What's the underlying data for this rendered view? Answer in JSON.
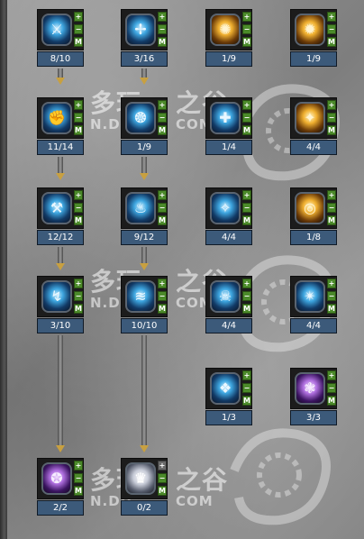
{
  "watermarks": [
    {
      "big": "多玩",
      "small": "N.DU"
    },
    {
      "big": "之谷",
      "small": "COM"
    }
  ],
  "skills": [
    {
      "id": "s1",
      "level": "8/10",
      "icon": "sword-slash-icon",
      "glyph": "⚔",
      "style": "blue",
      "plus_enabled": true
    },
    {
      "id": "s2",
      "level": "3/16",
      "icon": "axe-icon",
      "glyph": "✢",
      "style": "blue",
      "plus_enabled": true
    },
    {
      "id": "s3",
      "level": "1/9",
      "icon": "sun-icon",
      "glyph": "✺",
      "style": "gold",
      "plus_enabled": true
    },
    {
      "id": "s4",
      "level": "1/9",
      "icon": "flame-burst-icon",
      "glyph": "✹",
      "style": "gold",
      "plus_enabled": true
    },
    {
      "id": "s5",
      "level": "11/14",
      "icon": "fist-icon",
      "glyph": "✊",
      "style": "blue",
      "plus_enabled": true
    },
    {
      "id": "s6",
      "level": "1/9",
      "icon": "shield-orb-icon",
      "glyph": "❂",
      "style": "blue",
      "plus_enabled": true
    },
    {
      "id": "s7",
      "level": "1/4",
      "icon": "armor-icon",
      "glyph": "✚",
      "style": "blue",
      "plus_enabled": true
    },
    {
      "id": "s8",
      "level": "4/4",
      "icon": "fire-icon",
      "glyph": "✦",
      "style": "gold",
      "plus_enabled": true
    },
    {
      "id": "s9",
      "level": "12/12",
      "icon": "hammer-icon",
      "glyph": "⚒",
      "style": "blue",
      "plus_enabled": true
    },
    {
      "id": "s10",
      "level": "9/12",
      "icon": "blue-flame-icon",
      "glyph": "♨",
      "style": "blue",
      "plus_enabled": true
    },
    {
      "id": "s11",
      "level": "4/4",
      "icon": "spirit-icon",
      "glyph": "✧",
      "style": "blue",
      "plus_enabled": true
    },
    {
      "id": "s12",
      "level": "1/8",
      "icon": "golden-ring-icon",
      "glyph": "◎",
      "style": "gold",
      "plus_enabled": true
    },
    {
      "id": "s13",
      "level": "3/10",
      "icon": "lightning-icon",
      "glyph": "↯",
      "style": "blue",
      "plus_enabled": true
    },
    {
      "id": "s14",
      "level": "10/10",
      "icon": "wave-strike-icon",
      "glyph": "≋",
      "style": "blue",
      "plus_enabled": true
    },
    {
      "id": "s15",
      "level": "4/4",
      "icon": "skull-icon",
      "glyph": "☠",
      "style": "blue",
      "plus_enabled": true
    },
    {
      "id": "s16",
      "level": "4/4",
      "icon": "burst-icon",
      "glyph": "✴",
      "style": "blue",
      "plus_enabled": true
    },
    {
      "id": "s17",
      "level": "1/3",
      "icon": "bear-icon",
      "glyph": "❖",
      "style": "blue",
      "plus_enabled": true
    },
    {
      "id": "s18",
      "level": "3/3",
      "icon": "roar-icon",
      "glyph": "❃",
      "style": "purple",
      "plus_enabled": true
    },
    {
      "id": "s19",
      "level": "2/2",
      "icon": "vortex-icon",
      "glyph": "✪",
      "style": "purple",
      "plus_enabled": true
    },
    {
      "id": "s20",
      "level": "0/2",
      "icon": "crown-spikes-icon",
      "glyph": "♛",
      "style": "white",
      "plus_enabled": false
    }
  ],
  "button_labels": {
    "plus": "+",
    "minus": "−",
    "m": "M"
  },
  "colors": {
    "arrow": "#c8a040",
    "level_bg": "#3c5a7a",
    "button": "#4b8a2a"
  }
}
